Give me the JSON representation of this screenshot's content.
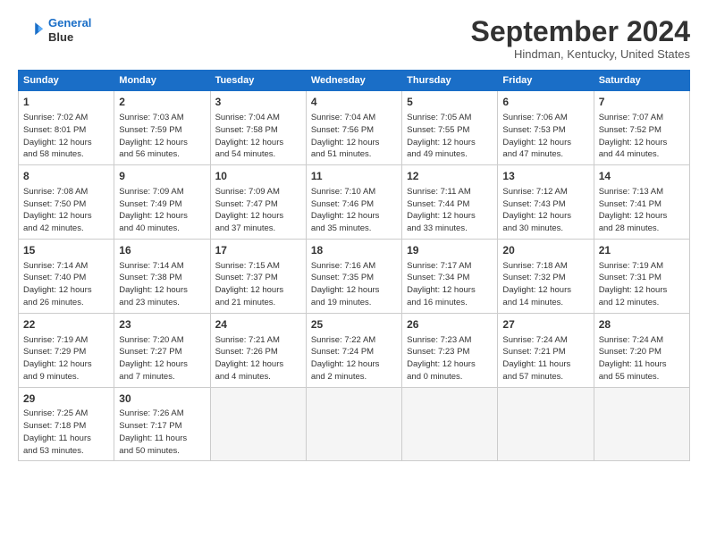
{
  "header": {
    "logo_line1": "General",
    "logo_line2": "Blue",
    "month": "September 2024",
    "location": "Hindman, Kentucky, United States"
  },
  "days_of_week": [
    "Sunday",
    "Monday",
    "Tuesday",
    "Wednesday",
    "Thursday",
    "Friday",
    "Saturday"
  ],
  "weeks": [
    [
      {
        "day": "1",
        "info": "Sunrise: 7:02 AM\nSunset: 8:01 PM\nDaylight: 12 hours\nand 58 minutes."
      },
      {
        "day": "2",
        "info": "Sunrise: 7:03 AM\nSunset: 7:59 PM\nDaylight: 12 hours\nand 56 minutes."
      },
      {
        "day": "3",
        "info": "Sunrise: 7:04 AM\nSunset: 7:58 PM\nDaylight: 12 hours\nand 54 minutes."
      },
      {
        "day": "4",
        "info": "Sunrise: 7:04 AM\nSunset: 7:56 PM\nDaylight: 12 hours\nand 51 minutes."
      },
      {
        "day": "5",
        "info": "Sunrise: 7:05 AM\nSunset: 7:55 PM\nDaylight: 12 hours\nand 49 minutes."
      },
      {
        "day": "6",
        "info": "Sunrise: 7:06 AM\nSunset: 7:53 PM\nDaylight: 12 hours\nand 47 minutes."
      },
      {
        "day": "7",
        "info": "Sunrise: 7:07 AM\nSunset: 7:52 PM\nDaylight: 12 hours\nand 44 minutes."
      }
    ],
    [
      {
        "day": "8",
        "info": "Sunrise: 7:08 AM\nSunset: 7:50 PM\nDaylight: 12 hours\nand 42 minutes."
      },
      {
        "day": "9",
        "info": "Sunrise: 7:09 AM\nSunset: 7:49 PM\nDaylight: 12 hours\nand 40 minutes."
      },
      {
        "day": "10",
        "info": "Sunrise: 7:09 AM\nSunset: 7:47 PM\nDaylight: 12 hours\nand 37 minutes."
      },
      {
        "day": "11",
        "info": "Sunrise: 7:10 AM\nSunset: 7:46 PM\nDaylight: 12 hours\nand 35 minutes."
      },
      {
        "day": "12",
        "info": "Sunrise: 7:11 AM\nSunset: 7:44 PM\nDaylight: 12 hours\nand 33 minutes."
      },
      {
        "day": "13",
        "info": "Sunrise: 7:12 AM\nSunset: 7:43 PM\nDaylight: 12 hours\nand 30 minutes."
      },
      {
        "day": "14",
        "info": "Sunrise: 7:13 AM\nSunset: 7:41 PM\nDaylight: 12 hours\nand 28 minutes."
      }
    ],
    [
      {
        "day": "15",
        "info": "Sunrise: 7:14 AM\nSunset: 7:40 PM\nDaylight: 12 hours\nand 26 minutes."
      },
      {
        "day": "16",
        "info": "Sunrise: 7:14 AM\nSunset: 7:38 PM\nDaylight: 12 hours\nand 23 minutes."
      },
      {
        "day": "17",
        "info": "Sunrise: 7:15 AM\nSunset: 7:37 PM\nDaylight: 12 hours\nand 21 minutes."
      },
      {
        "day": "18",
        "info": "Sunrise: 7:16 AM\nSunset: 7:35 PM\nDaylight: 12 hours\nand 19 minutes."
      },
      {
        "day": "19",
        "info": "Sunrise: 7:17 AM\nSunset: 7:34 PM\nDaylight: 12 hours\nand 16 minutes."
      },
      {
        "day": "20",
        "info": "Sunrise: 7:18 AM\nSunset: 7:32 PM\nDaylight: 12 hours\nand 14 minutes."
      },
      {
        "day": "21",
        "info": "Sunrise: 7:19 AM\nSunset: 7:31 PM\nDaylight: 12 hours\nand 12 minutes."
      }
    ],
    [
      {
        "day": "22",
        "info": "Sunrise: 7:19 AM\nSunset: 7:29 PM\nDaylight: 12 hours\nand 9 minutes."
      },
      {
        "day": "23",
        "info": "Sunrise: 7:20 AM\nSunset: 7:27 PM\nDaylight: 12 hours\nand 7 minutes."
      },
      {
        "day": "24",
        "info": "Sunrise: 7:21 AM\nSunset: 7:26 PM\nDaylight: 12 hours\nand 4 minutes."
      },
      {
        "day": "25",
        "info": "Sunrise: 7:22 AM\nSunset: 7:24 PM\nDaylight: 12 hours\nand 2 minutes."
      },
      {
        "day": "26",
        "info": "Sunrise: 7:23 AM\nSunset: 7:23 PM\nDaylight: 12 hours\nand 0 minutes."
      },
      {
        "day": "27",
        "info": "Sunrise: 7:24 AM\nSunset: 7:21 PM\nDaylight: 11 hours\nand 57 minutes."
      },
      {
        "day": "28",
        "info": "Sunrise: 7:24 AM\nSunset: 7:20 PM\nDaylight: 11 hours\nand 55 minutes."
      }
    ],
    [
      {
        "day": "29",
        "info": "Sunrise: 7:25 AM\nSunset: 7:18 PM\nDaylight: 11 hours\nand 53 minutes."
      },
      {
        "day": "30",
        "info": "Sunrise: 7:26 AM\nSunset: 7:17 PM\nDaylight: 11 hours\nand 50 minutes."
      },
      {
        "day": "",
        "info": ""
      },
      {
        "day": "",
        "info": ""
      },
      {
        "day": "",
        "info": ""
      },
      {
        "day": "",
        "info": ""
      },
      {
        "day": "",
        "info": ""
      }
    ]
  ]
}
